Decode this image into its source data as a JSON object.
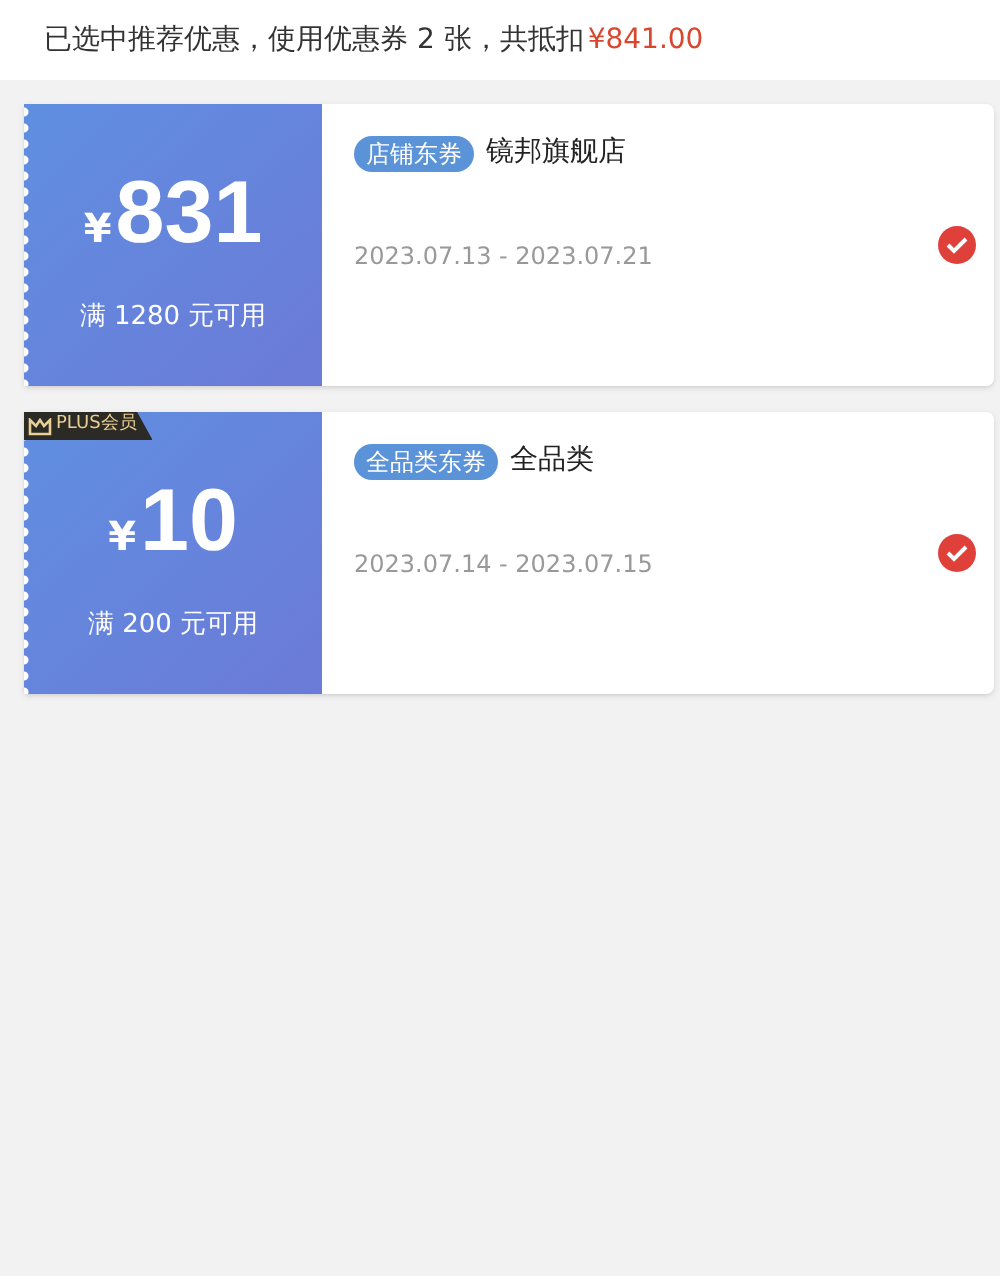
{
  "header": {
    "text": "已选中推荐优惠，使用优惠券 2 张，共抵扣",
    "amount": "¥841.00"
  },
  "coupons": [
    {
      "currency": "¥",
      "amount": "831",
      "condition": "满 1280 元可用",
      "tag": "店铺东券",
      "name": "镜邦旗舰店",
      "dates": "2023.07.13 - 2023.07.21",
      "selected": true
    },
    {
      "badge": "PLUS会员",
      "currency": "¥",
      "amount": "10",
      "condition": "满 200 元可用",
      "tag": "全品类东券",
      "name": "全品类",
      "dates": "2023.07.14 - 2023.07.15",
      "selected": true
    }
  ]
}
